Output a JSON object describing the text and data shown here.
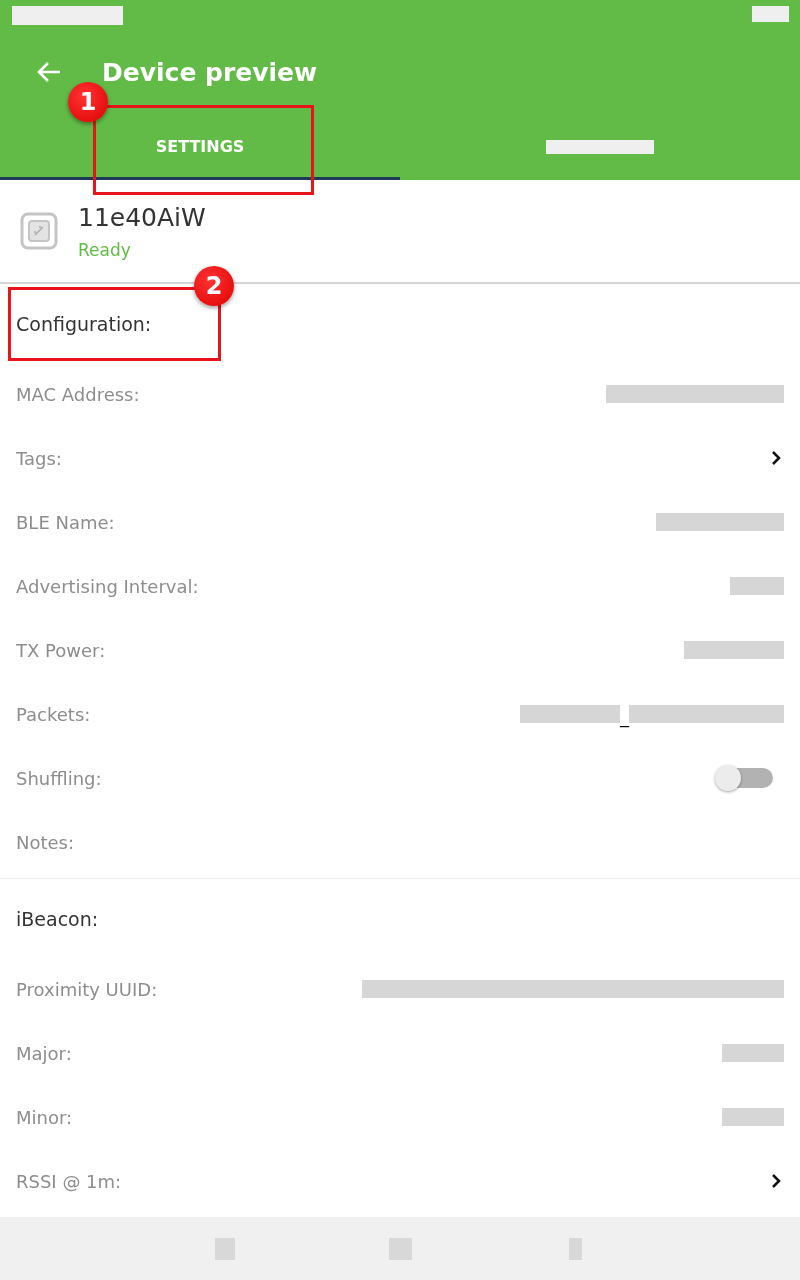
{
  "app_bar": {
    "title": "Device preview"
  },
  "tabs": [
    {
      "label": "SETTINGS",
      "selected": true,
      "kind": "text"
    },
    {
      "selected": false,
      "kind": "redacted"
    }
  ],
  "device": {
    "name": "11e40AiW",
    "status": "Ready"
  },
  "sections": [
    {
      "title": "Configuration:",
      "rows": [
        {
          "label": "MAC Address:",
          "kind": "redacted"
        },
        {
          "label": "Tags:",
          "kind": "chevron"
        },
        {
          "label": "BLE Name:",
          "kind": "redacted"
        },
        {
          "label": "Advertising Interval:",
          "kind": "redacted"
        },
        {
          "label": "TX Power:",
          "kind": "redacted"
        },
        {
          "label": "Packets:",
          "kind": "split",
          "separator": "_"
        },
        {
          "label": "Shuffling:",
          "kind": "toggle",
          "on": false
        },
        {
          "label": "Notes:",
          "kind": "empty"
        }
      ]
    },
    {
      "title": "iBeacon:",
      "rows": [
        {
          "label": "Proximity UUID:",
          "kind": "redacted"
        },
        {
          "label": "Major:",
          "kind": "redacted"
        },
        {
          "label": "Minor:",
          "kind": "redacted"
        },
        {
          "label": "RSSI @ 1m:",
          "kind": "chevron"
        }
      ]
    }
  ],
  "annotations": [
    {
      "number": "1"
    },
    {
      "number": "2"
    }
  ]
}
